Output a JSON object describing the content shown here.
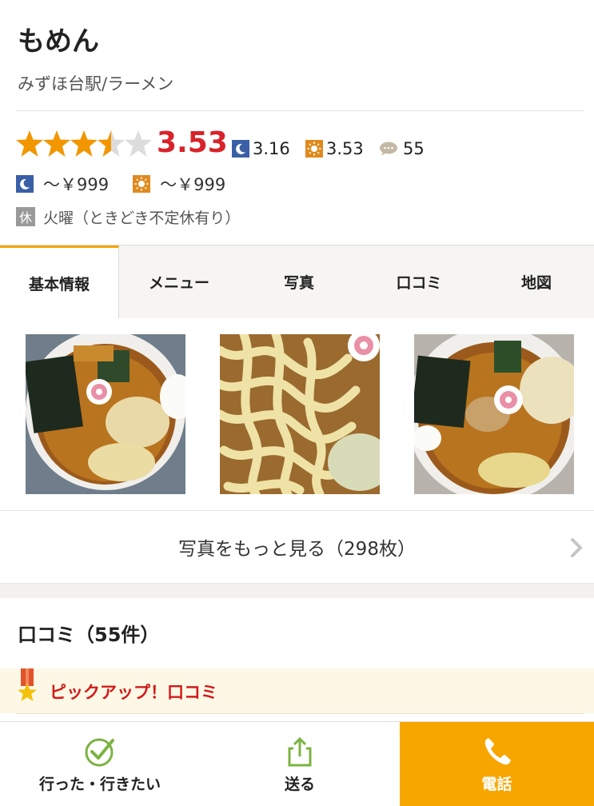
{
  "shop": {
    "name": "もめん",
    "subtitle": "みずほ台駅/ラーメン"
  },
  "rating": {
    "score": "3.53",
    "stars_value": 3.5,
    "night_score": "3.16",
    "day_score": "3.53",
    "review_count": "55"
  },
  "prices": {
    "night": "～￥999",
    "day": "～￥999"
  },
  "holiday": {
    "badge": "休",
    "text": "火曜（ときどき不定休有り）"
  },
  "tabs": [
    {
      "label": "基本情報",
      "active": true
    },
    {
      "label": "メニュー",
      "active": false
    },
    {
      "label": "写真",
      "active": false
    },
    {
      "label": "口コミ",
      "active": false
    },
    {
      "label": "地図",
      "active": false
    }
  ],
  "photos": {
    "more_label": "写真をもっと見る（298枚）"
  },
  "reviews": {
    "title": "口コミ（55件）",
    "pickup_label": "ピックアップ！口コミ"
  },
  "bottom_bar": {
    "went_label": "行った・行きたい",
    "send_label": "送る",
    "call_label": "電話"
  },
  "colors": {
    "accent": "#f7a600",
    "score_red": "#d8232a",
    "star_orange": "#f29600"
  }
}
